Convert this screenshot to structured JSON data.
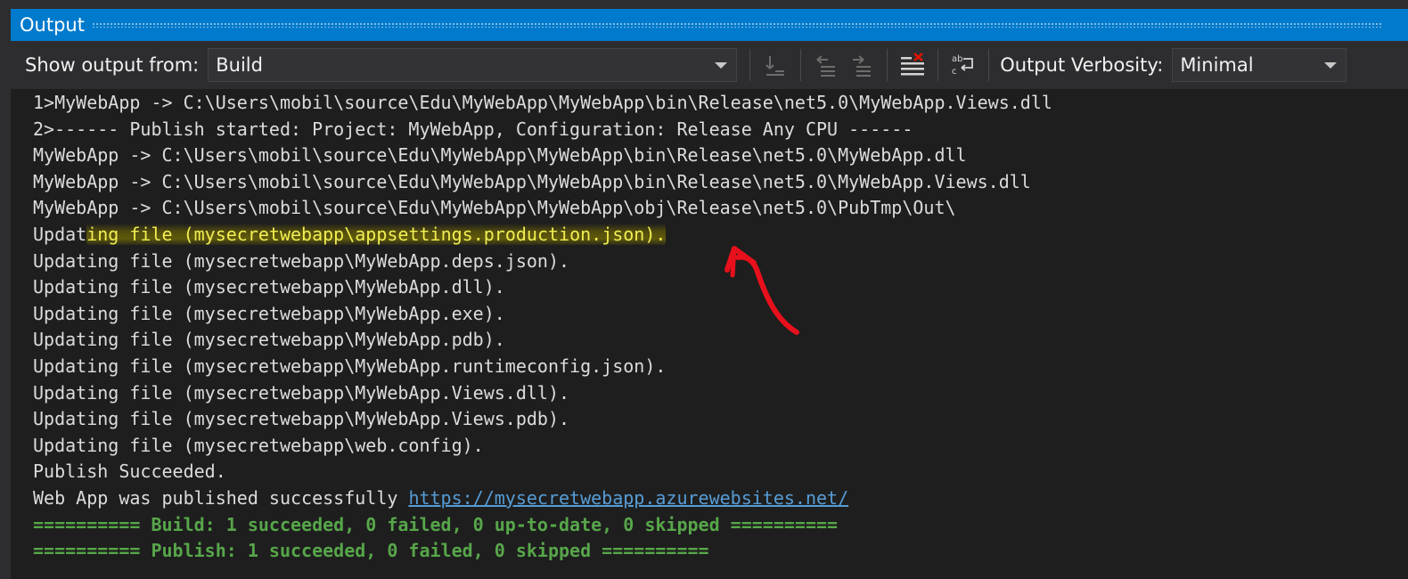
{
  "window": {
    "title": "Output"
  },
  "toolbar": {
    "show_output_label": "Show output from:",
    "show_output_value": "Build",
    "verbosity_label": "Output Verbosity:",
    "verbosity_value": "Minimal"
  },
  "output": {
    "lines": [
      "1>MyWebApp -> C:\\Users\\mobil\\source\\Edu\\MyWebApp\\MyWebApp\\bin\\Release\\net5.0\\MyWebApp.Views.dll",
      "2>------ Publish started: Project: MyWebApp, Configuration: Release Any CPU ------",
      "MyWebApp -> C:\\Users\\mobil\\source\\Edu\\MyWebApp\\MyWebApp\\bin\\Release\\net5.0\\MyWebApp.dll",
      "MyWebApp -> C:\\Users\\mobil\\source\\Edu\\MyWebApp\\MyWebApp\\bin\\Release\\net5.0\\MyWebApp.Views.dll",
      "MyWebApp -> C:\\Users\\mobil\\source\\Edu\\MyWebApp\\MyWebApp\\obj\\Release\\net5.0\\PubTmp\\Out\\"
    ],
    "highlight_prefix": "Updat",
    "highlight_text": "ing file (mysecretwebapp\\appsettings.production.json).",
    "updates": [
      "Updating file (mysecretwebapp\\MyWebApp.deps.json).",
      "Updating file (mysecretwebapp\\MyWebApp.dll).",
      "Updating file (mysecretwebapp\\MyWebApp.exe).",
      "Updating file (mysecretwebapp\\MyWebApp.pdb).",
      "Updating file (mysecretwebapp\\MyWebApp.runtimeconfig.json).",
      "Updating file (mysecretwebapp\\MyWebApp.Views.dll).",
      "Updating file (mysecretwebapp\\MyWebApp.Views.pdb).",
      "Updating file (mysecretwebapp\\web.config).",
      "Publish Succeeded."
    ],
    "published_prefix": "Web App was published successfully ",
    "published_url": "https://mysecretwebapp.azurewebsites.net/",
    "build_summary": "========== Build: 1 succeeded, 0 failed, 0 up-to-date, 0 skipped ==========",
    "publish_summary": "========== Publish: 1 succeeded, 0 failed, 0 skipped =========="
  },
  "colors": {
    "accent": "#007acc",
    "summary_green": "#57a64a",
    "link_blue": "#569cd6",
    "annotation_red": "#e8101c",
    "highlight_yellow": "#f2ee52"
  }
}
